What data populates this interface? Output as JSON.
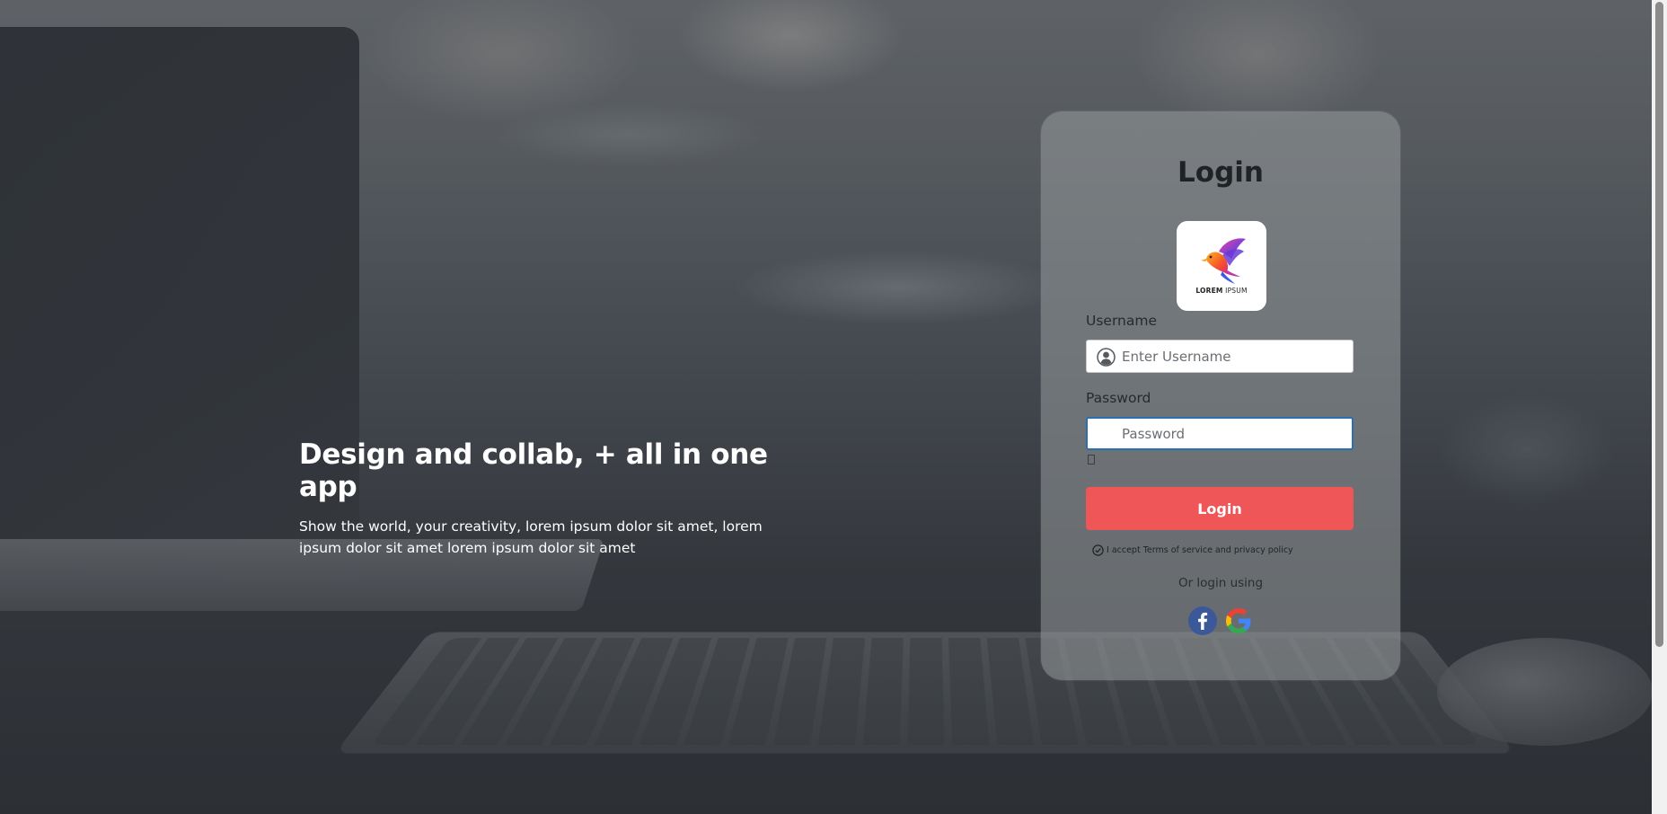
{
  "hero": {
    "title": "Design and collab, + all in one app",
    "subtitle": "Show the world, your creativity, lorem ipsum dolor sit amet, lorem ipsum dolor sit amet lorem ipsum dolor sit amet"
  },
  "login": {
    "title": "Login",
    "logo": {
      "text_bold": "LOREM",
      "text_light": " IPSUM"
    },
    "username": {
      "label": "Username",
      "placeholder": "Enter Username",
      "icon": "user-circle-icon"
    },
    "password": {
      "label": "Password",
      "placeholder": "Password",
      "toggle_icon": "show-password-icon"
    },
    "submit_label": "Login",
    "terms_text": "I accept Terms of service and privacy policy",
    "alt_login_text": "Or login using",
    "social": [
      {
        "name": "facebook",
        "icon": "facebook-icon",
        "color": "#3b5998"
      },
      {
        "name": "google",
        "icon": "google-icon"
      }
    ],
    "accent_color": "#ef5657"
  }
}
